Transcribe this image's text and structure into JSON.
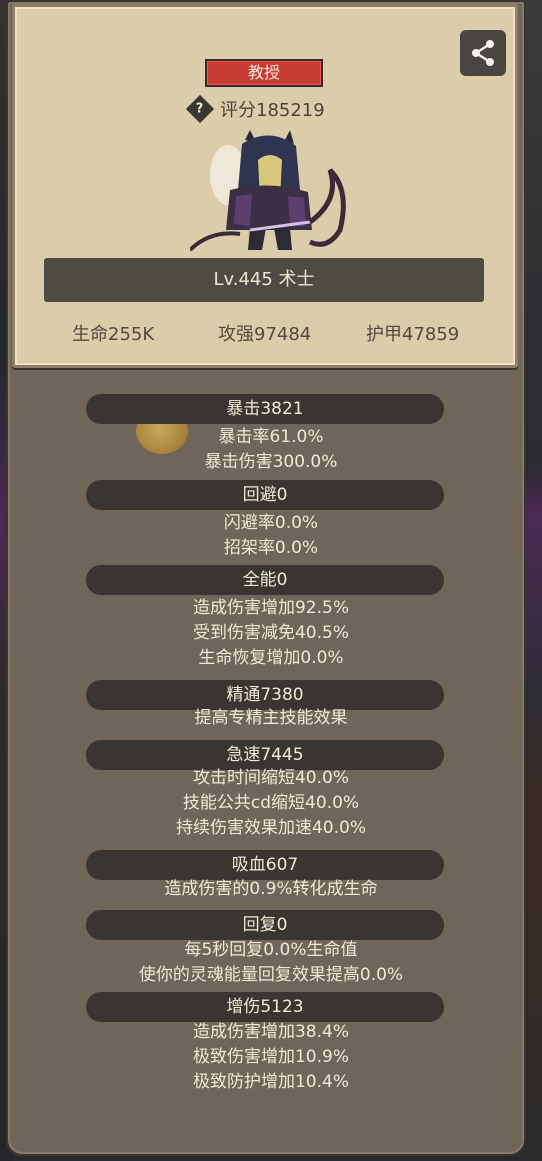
{
  "card": {
    "title_badge": "教授",
    "score_label": "评分185219",
    "help_glyph": "?",
    "level_label": "Lv.445 术士",
    "core_stats": {
      "hp": "生命255K",
      "attack": "攻强97484",
      "armor": "护甲47859"
    }
  },
  "icons": {
    "share": "share-icon",
    "help": "help-icon",
    "hero": "hero-portrait-warlock",
    "coin": "coin-icon"
  },
  "colors": {
    "panel": "#6f6659",
    "card": "#dccdaa",
    "badge": "#c83a34",
    "header_pill": "#3a3530",
    "text_light": "#f1e8d5"
  },
  "stats": [
    {
      "header": "暴击3821",
      "lines": [
        "暴击率61.0%",
        "暴击伤害300.0%"
      ]
    },
    {
      "header": "回避0",
      "lines": [
        "闪避率0.0%",
        "招架率0.0%"
      ]
    },
    {
      "header": "全能0",
      "lines": [
        "造成伤害增加92.5%",
        "受到伤害减免40.5%",
        "生命恢复增加0.0%"
      ]
    },
    {
      "header": "精通7380",
      "lines": [
        "提高专精主技能效果"
      ]
    },
    {
      "header": "急速7445",
      "lines": [
        "攻击时间缩短40.0%",
        "技能公共cd缩短40.0%",
        "持续伤害效果加速40.0%"
      ]
    },
    {
      "header": "吸血607",
      "lines": [
        "造成伤害的0.9%转化成生命"
      ]
    },
    {
      "header": "回复0",
      "lines": [
        "每5秒回复0.0%生命值",
        "使你的灵魂能量回复效果提高0.0%"
      ]
    },
    {
      "header": "增伤5123",
      "lines": [
        "造成伤害增加38.4%",
        "极致伤害增加10.9%",
        "极致防护增加10.4%"
      ]
    }
  ]
}
